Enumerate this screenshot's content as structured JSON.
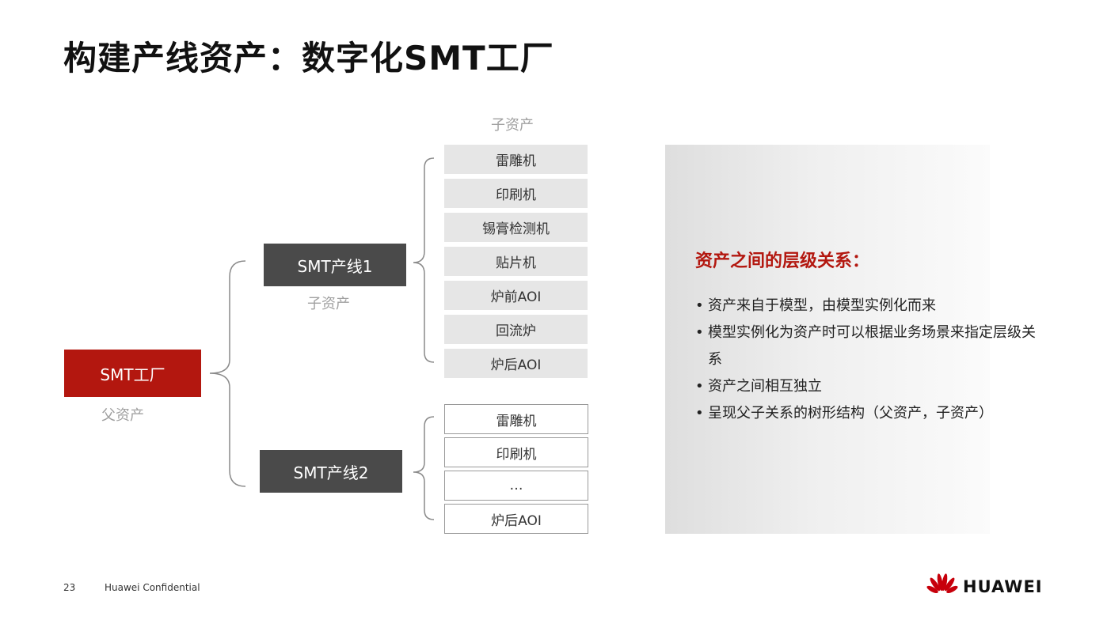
{
  "title": "构建产线资产：数字化SMT工厂",
  "diagram": {
    "child_asset_top_label": "子资产",
    "factory": {
      "label": "SMT工厂",
      "caption": "父资产"
    },
    "line1": {
      "label": "SMT产线1",
      "caption": "子资产",
      "children": [
        "雷雕机",
        "印刷机",
        "锡膏检测机",
        "贴片机",
        "炉前AOI",
        "回流炉",
        "炉后AOI"
      ]
    },
    "line2": {
      "label": "SMT产线2",
      "children": [
        "雷雕机",
        "印刷机",
        "…",
        "炉后AOI"
      ]
    }
  },
  "panel": {
    "title": "资产之间的层级关系：",
    "bullets": [
      "资产来自于模型，由模型实例化而来",
      "模型实例化为资产时可以根据业务场景来指定层级关系",
      "资产之间相互独立",
      "呈现父子关系的树形结构（父资产，子资产）"
    ]
  },
  "footer": {
    "page_number": "23",
    "confidential": "Huawei Confidential",
    "brand": "HUAWEI"
  },
  "colors": {
    "brand_red": "#b3170f",
    "dark_gray": "#4a4a4a",
    "light_gray": "#e6e6e6"
  }
}
